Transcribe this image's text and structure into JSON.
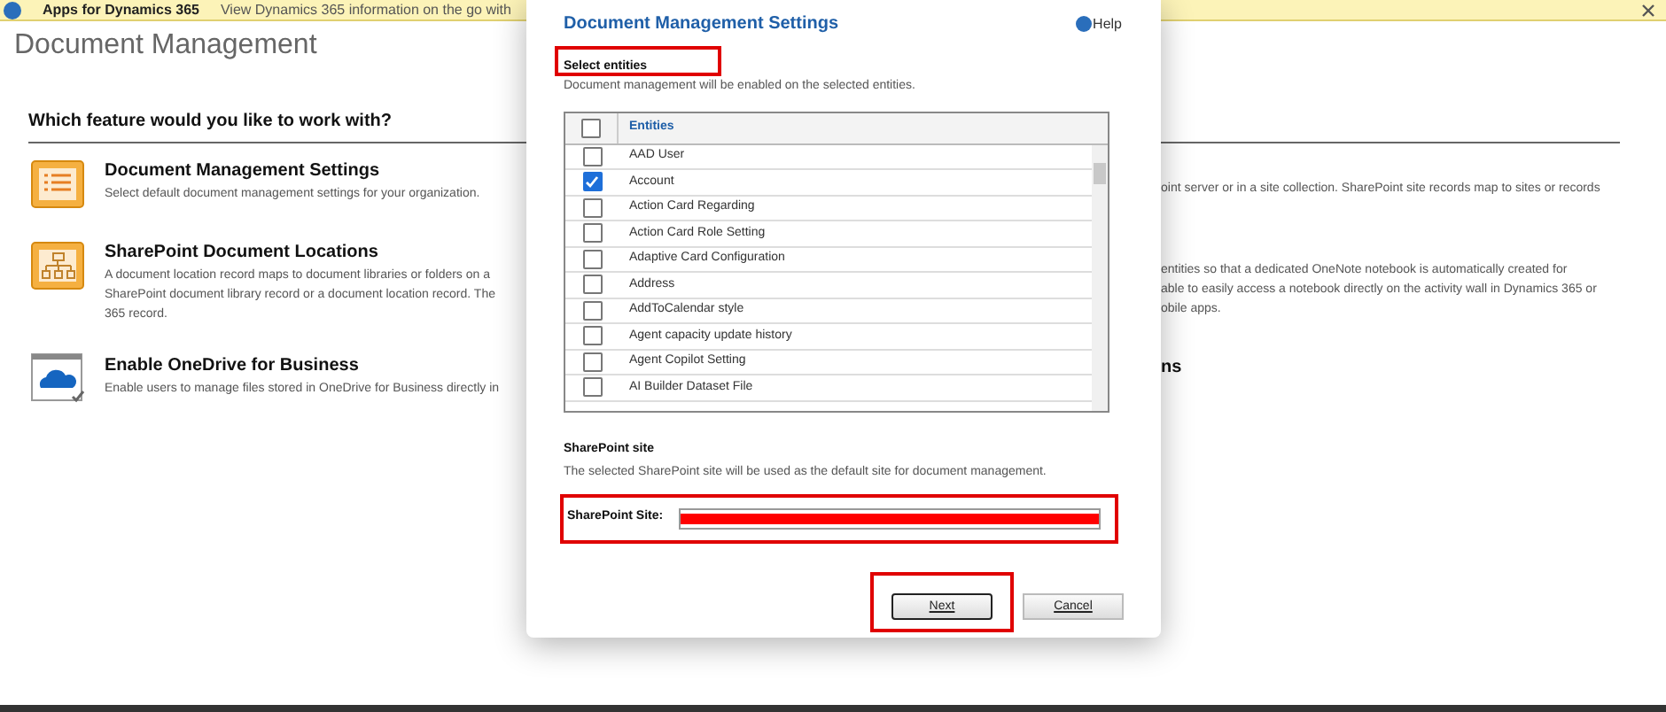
{
  "banner": {
    "title": "Apps for Dynamics 365",
    "message": "View Dynamics 365 information on the go with"
  },
  "page": {
    "title": "Document Management",
    "heading": "Which feature would you like to work with?"
  },
  "features": [
    {
      "kind": "settings",
      "title": "Document Management Settings",
      "left_lines": [
        "Select default document management settings for your organization."
      ],
      "right_lines": [
        "oint server or in a site collection. SharePoint site records map to sites or records"
      ]
    },
    {
      "kind": "locations",
      "title": "SharePoint Document Locations",
      "left_lines": [
        "A document location record maps to document libraries or folders on a",
        "SharePoint document library record or a document location record. The",
        "365 record."
      ],
      "right_lines": [
        "entities so that a dedicated OneNote notebook is automatically created for",
        "able to easily access a notebook directly on the activity wall in Dynamics 365 or",
        "obile apps."
      ]
    },
    {
      "kind": "onedrive",
      "title": "Enable OneDrive for Business",
      "left_lines": [
        "Enable users to manage files stored in OneDrive for Business directly in"
      ],
      "right_title": "ns"
    }
  ],
  "dialog": {
    "title": "Document Management Settings",
    "help": "Help",
    "section1": {
      "title": "Select entities",
      "description": "Document management will be enabled on the selected entities."
    },
    "table": {
      "column": "Entities",
      "all_checked": false,
      "rows": [
        {
          "name": "AAD User",
          "checked": false
        },
        {
          "name": "Account",
          "checked": true
        },
        {
          "name": "Action Card Regarding",
          "checked": false
        },
        {
          "name": "Action Card Role Setting",
          "checked": false
        },
        {
          "name": "Adaptive Card Configuration",
          "checked": false
        },
        {
          "name": "Address",
          "checked": false
        },
        {
          "name": "AddToCalendar style",
          "checked": false
        },
        {
          "name": "Agent capacity update history",
          "checked": false
        },
        {
          "name": "Agent Copilot Setting",
          "checked": false
        },
        {
          "name": "AI Builder Dataset File",
          "checked": false
        }
      ]
    },
    "section2": {
      "title": "SharePoint site",
      "description": "The selected SharePoint site will be used as the default site for document management."
    },
    "site_label": "SharePoint Site:",
    "buttons": [
      {
        "label": "Next",
        "selected": true
      },
      {
        "label": "Cancel",
        "selected": false
      }
    ]
  }
}
